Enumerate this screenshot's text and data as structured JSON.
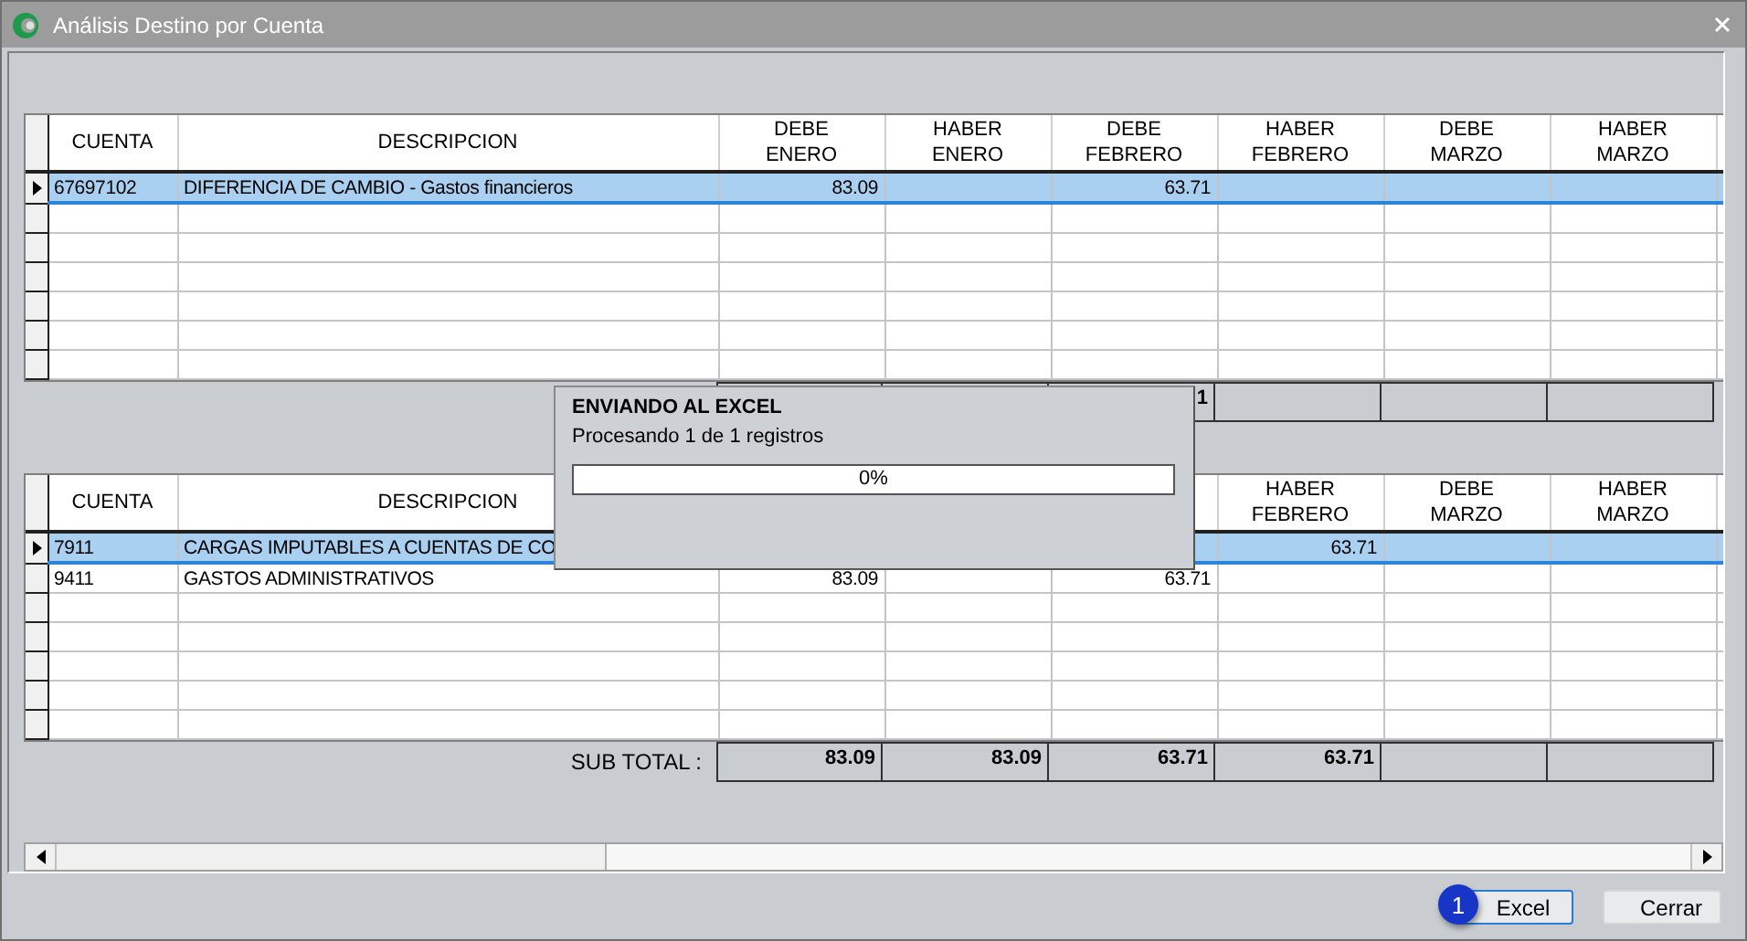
{
  "window": {
    "title": "Análisis Destino por Cuenta"
  },
  "grids": [
    {
      "columns": {
        "cuenta": [
          "CUENTA"
        ],
        "descripcion": [
          "DESCRIPCION"
        ],
        "debe_enero": [
          "DEBE",
          "ENERO"
        ],
        "haber_enero": [
          "HABER",
          "ENERO"
        ],
        "debe_febrero": [
          "DEBE",
          "FEBRERO"
        ],
        "haber_febrero": [
          "HABER",
          "FEBRERO"
        ],
        "debe_marzo": [
          "DEBE",
          "MARZO"
        ],
        "haber_marzo": [
          "HABER",
          "MARZO"
        ]
      },
      "rows": [
        {
          "selected": true,
          "cuenta": "67697102",
          "descripcion": "DIFERENCIA DE CAMBIO - Gastos financieros",
          "values": {
            "debe_enero": "83.09",
            "debe_febrero": "63.71"
          }
        }
      ],
      "totals": {
        "debe_febrero": "1"
      }
    },
    {
      "columns": {
        "cuenta": [
          "CUENTA"
        ],
        "descripcion": [
          "DESCRIPCION"
        ],
        "haber_febrero": [
          "HABER",
          "FEBRERO"
        ],
        "debe_marzo": [
          "DEBE",
          "MARZO"
        ],
        "haber_marzo": [
          "HABER",
          "MARZO"
        ]
      },
      "rows": [
        {
          "selected": true,
          "cuenta": "7911",
          "descripcion": "CARGAS IMPUTABLES A CUENTAS DE CO",
          "values": {
            "haber_febrero": "63.71"
          }
        },
        {
          "selected": false,
          "cuenta": "9411",
          "descripcion": "GASTOS ADMINISTRATIVOS",
          "values": {
            "debe_enero": "83.09",
            "debe_febrero": "63.71"
          }
        }
      ],
      "totals_label": "SUB TOTAL :",
      "totals": {
        "debe_enero": "83.09",
        "haber_enero": "83.09",
        "debe_febrero": "63.71",
        "haber_febrero": "63.71"
      }
    }
  ],
  "progress_dialog": {
    "title": "ENVIANDO AL EXCEL",
    "message": "Procesando 1 de 1 registros",
    "level": 0,
    "reading": "0%"
  },
  "buttons": [
    {
      "label": "Excel",
      "badge": "1",
      "focused": true
    },
    {
      "label": "Cerrar",
      "focused": false
    }
  ]
}
